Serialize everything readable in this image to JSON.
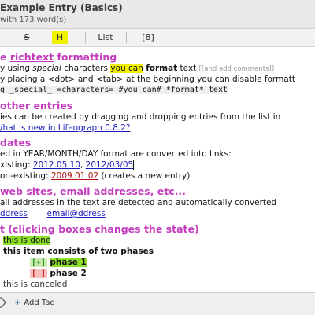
{
  "window": {
    "title": "Example Entry (Basics)",
    "subtitle": "with 173 word(s)"
  },
  "toolbar": {
    "strike_label": "S",
    "highlight_label": "H",
    "list_label": "List",
    "table_label": "[8]"
  },
  "entry": {
    "h_richtext_a": "e ",
    "h_richtext_b": "richtext",
    "h_richtext_c": " formatting",
    "l1_a": "y using ",
    "l1_b": "special",
    "l1_c": " ",
    "l1_d": "characters",
    "l1_e": " ",
    "l1_f": "you can",
    "l1_g": " ",
    "l1_h": "format",
    "l1_i": " text ",
    "l1_comment": "[[and add comments]]",
    "l2": "y placing a <dot> and <tab> at the beginning you can disable formatt",
    "l3": "g _special_ =characters= #you can# *format* text",
    "h_other": "other entries",
    "l4": "ies can be created by dragging and dropping entries from the list in",
    "l5_link": "/hat is new in Lifeograph 0.8.2?",
    "h_dates": "dates",
    "l6": "ed in YEAR/MONTH/DAY format are converted into links:",
    "l7_a": "xisting: ",
    "l7_link1": "2012.05.10",
    "l7_sep": ", ",
    "l7_link2": "2012/03/05",
    "l8_a": "on-existing: ",
    "l8_link": "2009.01.02",
    "l8_b": " (creates a new entry)",
    "h_web": "web sites, email addresses, etc...",
    "l9": "ail addresses in the text are detected and automatically converted",
    "l10_link1": "ddress",
    "l10_link2": "email@ddress",
    "h_check": "t (clicking boxes changes the state)",
    "c1": "this is done",
    "c2": "this item consists of two phases",
    "c3_box": "[+]",
    "c3": "phase 1",
    "c4_box": "[ ]",
    "c4": "phase 2",
    "c5": "this is canceled"
  },
  "footer": {
    "add_tag": "Add Tag"
  }
}
